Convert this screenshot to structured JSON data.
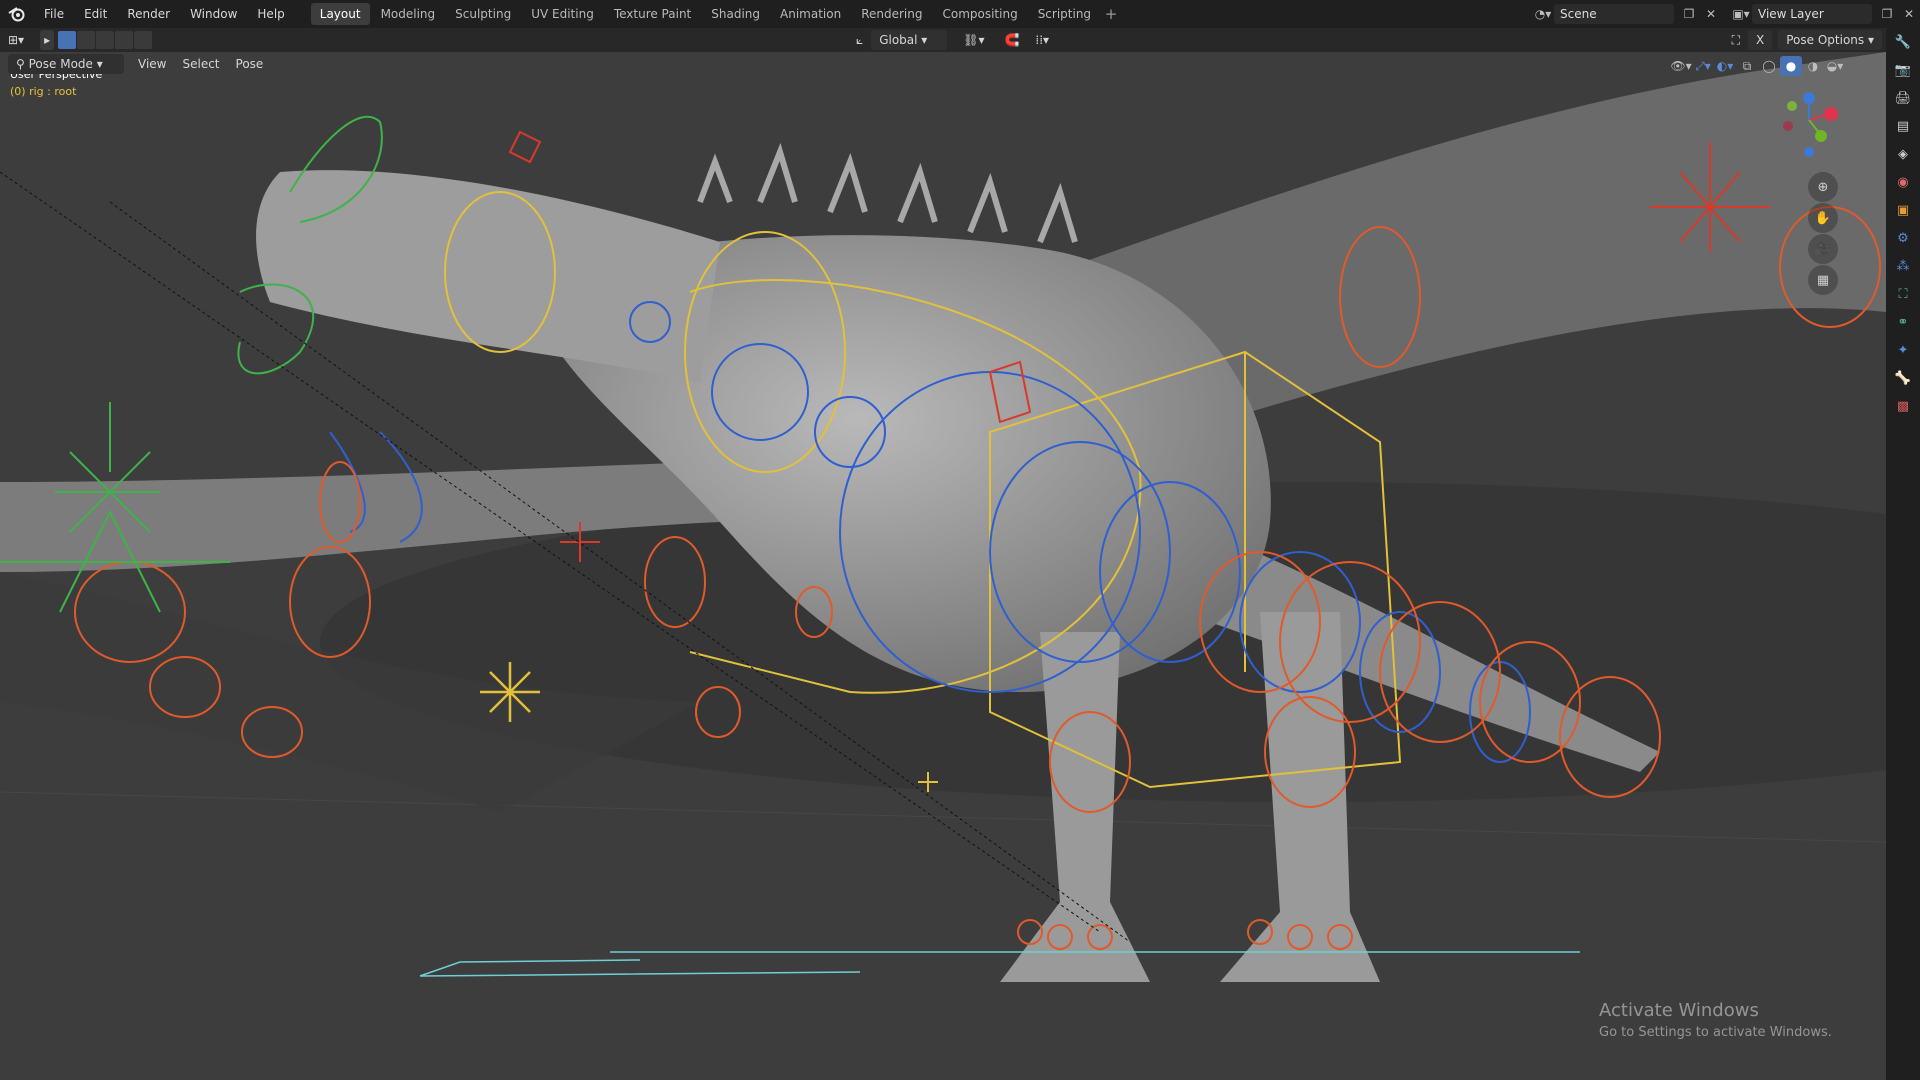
{
  "menu": {
    "items": [
      "File",
      "Edit",
      "Render",
      "Window",
      "Help"
    ]
  },
  "workspaces": {
    "tabs": [
      "Layout",
      "Modeling",
      "Sculpting",
      "UV Editing",
      "Texture Paint",
      "Shading",
      "Animation",
      "Rendering",
      "Compositing",
      "Scripting"
    ],
    "active": "Layout",
    "add": "+"
  },
  "scene": {
    "name": "Scene",
    "view_layer": "View Layer"
  },
  "header": {
    "mode": "Pose Mode",
    "view": "View",
    "select": "Select",
    "pose": "Pose",
    "transform": "Global",
    "pose_options": "Pose Options"
  },
  "viewport": {
    "perspective": "User Perspective",
    "object_info": "(0) rig : root"
  },
  "watermark": {
    "title": "Activate Windows",
    "subtitle": "Go to Settings to activate Windows."
  },
  "colors": {
    "accent": "#4772b3",
    "rig_yellow": "#e1c13a",
    "rig_orange": "#e05a2b",
    "rig_blue": "#2f5fd0",
    "rig_green": "#3fb24a",
    "rig_red": "#d83a2a"
  },
  "icons": {
    "logo": "blender-logo-icon",
    "right_strip": [
      "tool-icon",
      "render-icon",
      "output-icon",
      "view-layer-icon",
      "scene-icon",
      "world-icon",
      "object-icon",
      "modifier-icon",
      "particles-icon",
      "physics-icon",
      "constraint-icon",
      "data-icon",
      "bone-icon",
      "texture-icon"
    ]
  }
}
